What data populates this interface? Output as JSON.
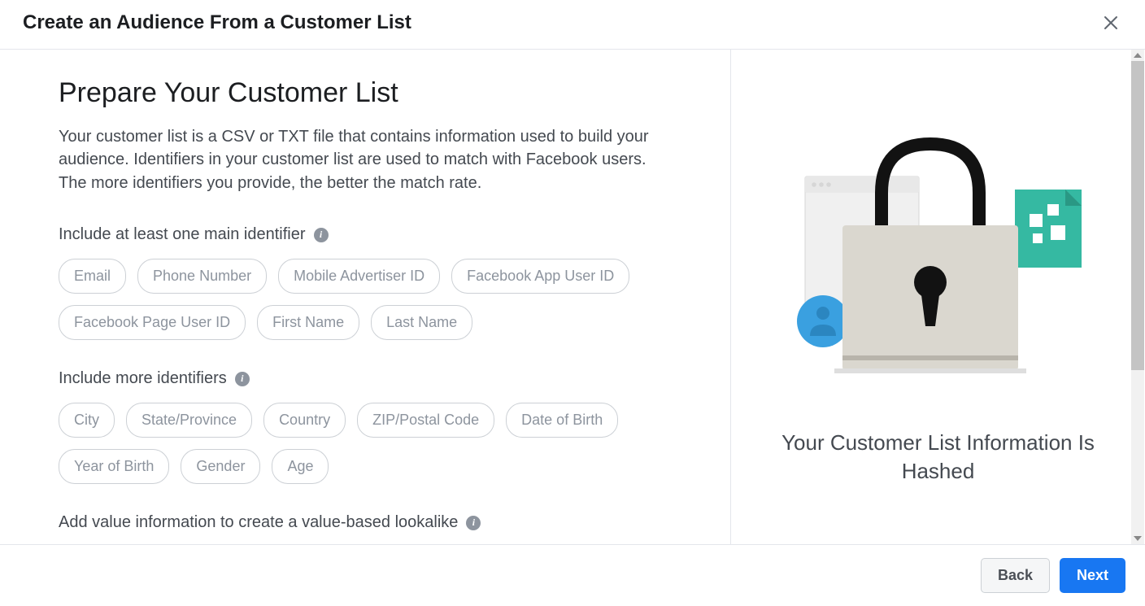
{
  "header": {
    "title": "Create an Audience From a Customer List"
  },
  "main": {
    "heading": "Prepare Your Customer List",
    "description": "Your customer list is a CSV or TXT file that contains information used to build your audience. Identifiers in your customer list are used to match with Facebook users. The more identifiers you provide, the better the match rate.",
    "section1_label": "Include at least one main identifier",
    "main_identifiers": [
      "Email",
      "Phone Number",
      "Mobile Advertiser ID",
      "Facebook App User ID",
      "Facebook Page User ID",
      "First Name",
      "Last Name"
    ],
    "section2_label": "Include more identifiers",
    "more_identifiers": [
      "City",
      "State/Province",
      "Country",
      "ZIP/Postal Code",
      "Date of Birth",
      "Year of Birth",
      "Gender",
      "Age"
    ],
    "section3_label": "Add value information to create a value-based lookalike"
  },
  "right": {
    "heading": "Your Customer List Information Is Hashed"
  },
  "footer": {
    "back_label": "Back",
    "next_label": "Next"
  },
  "icons": {
    "info_glyph": "i"
  }
}
